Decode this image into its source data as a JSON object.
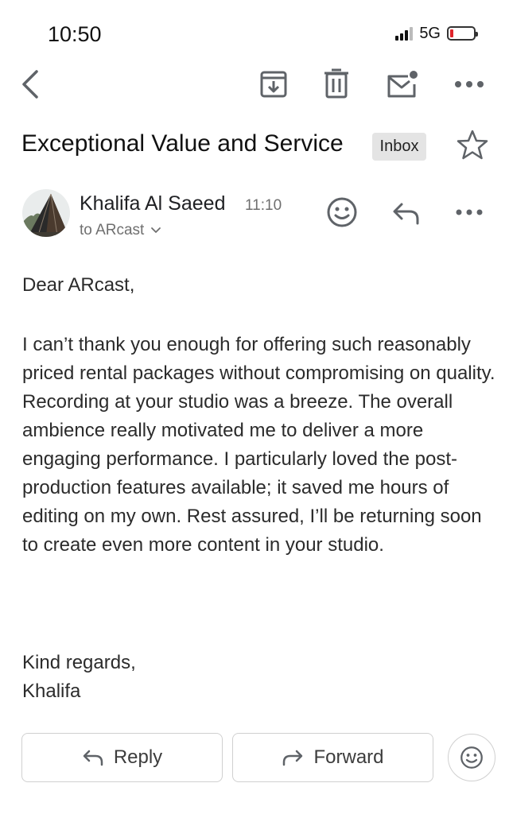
{
  "status_bar": {
    "time": "10:50",
    "network": "5G",
    "battery_level": 0.1
  },
  "toolbar": {
    "back_icon": "back-arrow-icon",
    "archive_icon": "archive-icon",
    "delete_icon": "trash-icon",
    "mark_unread_icon": "mark-unread-icon",
    "more_icon": "more-horizontal-icon"
  },
  "email": {
    "subject": "Exceptional Value and Service",
    "label": "Inbox",
    "starred": false,
    "sender": {
      "name": "Khalifa Al Saeed",
      "time": "11:10",
      "recipient": "to ARcast"
    },
    "greeting": "Dear ARcast,",
    "body": "I can’t thank you enough for offering such reasonably priced rental packages without compromising on quality. Recording at your studio was a breeze. The overall ambience really motivated me to deliver a more engaging performance. I particularly loved the post-production features available; it saved me hours of editing on my own. Rest assured, I’ll be returning soon to create even more content in your studio.",
    "closing": "Kind regards,",
    "signature": "Khalifa"
  },
  "actions": {
    "reply_label": "Reply",
    "forward_label": "Forward"
  },
  "colors": {
    "battery_low": "#e0242b",
    "badge_bg": "#e4e4e4",
    "icon": "#5f6368"
  }
}
